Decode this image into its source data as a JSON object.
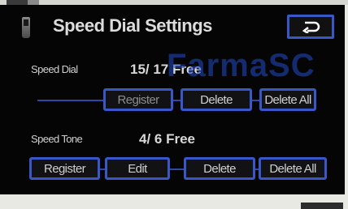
{
  "header": {
    "title": "Speed Dial Settings"
  },
  "speed_dial": {
    "label": "Speed Dial",
    "count": "15/ 17 Free",
    "buttons": {
      "register": "Register",
      "delete": "Delete",
      "delete_all": "Delete All"
    }
  },
  "speed_tone": {
    "label": "Speed Tone",
    "count": "4/  6 Free",
    "buttons": {
      "register": "Register",
      "edit": "Edit",
      "delete": "Delete",
      "delete_all": "Delete All"
    }
  },
  "watermark": "FarmaSC",
  "colors": {
    "button_border": "#3a57c8",
    "screen_bg": "#050505",
    "text": "#d8d8d8",
    "watermark": "#234bc8"
  },
  "icons": {
    "header_icon": "phone-icon",
    "back_button_icon": "return-arrow-icon"
  }
}
